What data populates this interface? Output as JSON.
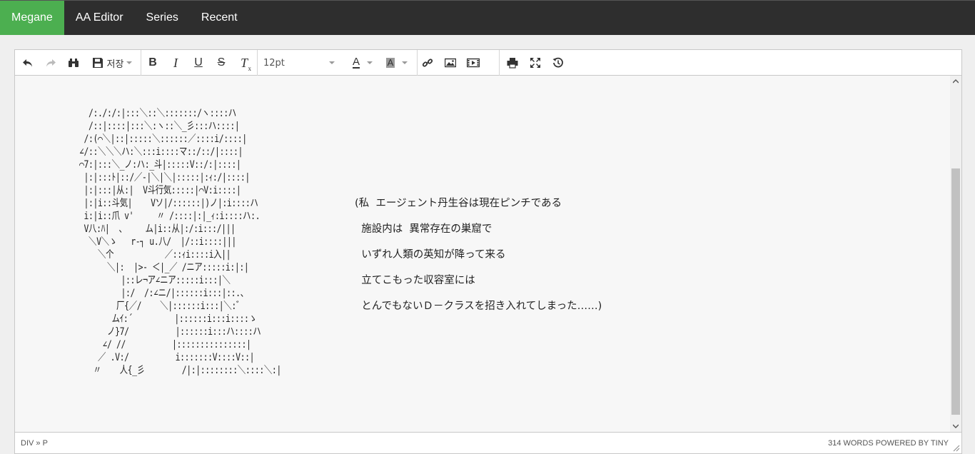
{
  "nav": {
    "items": [
      {
        "label": "Megane",
        "active": true
      },
      {
        "label": "AA Editor",
        "active": false
      },
      {
        "label": "Series",
        "active": false
      },
      {
        "label": "Recent",
        "active": false
      }
    ]
  },
  "toolbar": {
    "save_label": "저장",
    "font_size": "12pt",
    "icons": [
      "undo-icon",
      "redo-icon",
      "find-icon",
      "save-icon",
      "bold-icon",
      "italic-icon",
      "underline-icon",
      "strikethrough-icon",
      "clear-format-icon",
      "text-color-icon",
      "background-color-icon",
      "link-icon",
      "image-icon",
      "media-icon",
      "print-icon",
      "fullscreen-icon",
      "restore-draft-icon"
    ]
  },
  "content": {
    "ascii_art": "  /:./:/:|:::＼::＼:::::::/ヽ::::ハ\n  /::|::::|:::＼:ヽ::＼_彡:::ハ::::|\n /:(⌒＼|::|:::::＼::::::／::::i/::::|\n∠/::＼＼＼ハ:＼:::i::::マ::/::/|::::|\n⌒7:|:::＼_ノ:ハ:_斗|:::::V::/:|::::|\n |:|:::ﾄ|::/／-|＼|＼|:::::|:ｨ:/|::::|\n |:|:::|从:|  V斗行気:::::|⌒V:i::::|\n |:|i::斗気|    Vソ|/::::::|)ノ|:i::::ハ\n i:|i::爪 v'     〃 /::::|:|_ｨ:i::::ハ:.\n V八:ﾊ|  、    ム|i::从|:/:i:::/|||\n  ＼V＼ゝ   r‐┐ u.八/  |/::i::::|||\n    ＼个           ／::ｨi::::i入||\n      ＼|:  |>- ＜|_／ /ニア:::::i:|:|\n         |::レ¬ア∠ニア:::::i:::|＼\n         |:/  /:∠ニ/|::::::i:::|::.、\n        厂{／/    ＼|::::::i:::|＼:゛\n       ムｲ:´         |::::::i:::i::::ゝ\n      ノ}7/          |::::::i:::ハ::::ハ\n     ∠/ //          |:::::::::::::::|\n    ／ .V:/          i:::::::V::::V::|\n   〃    人{_彡        /|:|::::::::＼::::＼:|",
    "story_lines": [
      "(私  エージェント丹生谷は現在ピンチである",
      "  施設内は  異常存在の巣窟で",
      "  いずれ人類の英知が降って来る",
      "  立てこもった収容室には",
      "  とんでもないＤ－クラスを招き入れてしまった……)"
    ]
  },
  "status": {
    "path": "DIV » P",
    "wordcount": "314 WORDS POWERED BY TINY"
  }
}
